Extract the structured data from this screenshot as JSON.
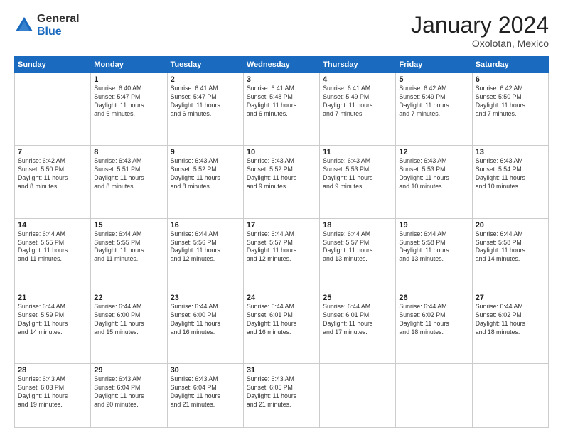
{
  "logo": {
    "general": "General",
    "blue": "Blue"
  },
  "header": {
    "month": "January 2024",
    "location": "Oxolotan, Mexico"
  },
  "weekdays": [
    "Sunday",
    "Monday",
    "Tuesday",
    "Wednesday",
    "Thursday",
    "Friday",
    "Saturday"
  ],
  "weeks": [
    [
      {
        "day": "",
        "info": ""
      },
      {
        "day": "1",
        "info": "Sunrise: 6:40 AM\nSunset: 5:47 PM\nDaylight: 11 hours\nand 6 minutes."
      },
      {
        "day": "2",
        "info": "Sunrise: 6:41 AM\nSunset: 5:47 PM\nDaylight: 11 hours\nand 6 minutes."
      },
      {
        "day": "3",
        "info": "Sunrise: 6:41 AM\nSunset: 5:48 PM\nDaylight: 11 hours\nand 6 minutes."
      },
      {
        "day": "4",
        "info": "Sunrise: 6:41 AM\nSunset: 5:49 PM\nDaylight: 11 hours\nand 7 minutes."
      },
      {
        "day": "5",
        "info": "Sunrise: 6:42 AM\nSunset: 5:49 PM\nDaylight: 11 hours\nand 7 minutes."
      },
      {
        "day": "6",
        "info": "Sunrise: 6:42 AM\nSunset: 5:50 PM\nDaylight: 11 hours\nand 7 minutes."
      }
    ],
    [
      {
        "day": "7",
        "info": "Sunrise: 6:42 AM\nSunset: 5:50 PM\nDaylight: 11 hours\nand 8 minutes."
      },
      {
        "day": "8",
        "info": "Sunrise: 6:43 AM\nSunset: 5:51 PM\nDaylight: 11 hours\nand 8 minutes."
      },
      {
        "day": "9",
        "info": "Sunrise: 6:43 AM\nSunset: 5:52 PM\nDaylight: 11 hours\nand 8 minutes."
      },
      {
        "day": "10",
        "info": "Sunrise: 6:43 AM\nSunset: 5:52 PM\nDaylight: 11 hours\nand 9 minutes."
      },
      {
        "day": "11",
        "info": "Sunrise: 6:43 AM\nSunset: 5:53 PM\nDaylight: 11 hours\nand 9 minutes."
      },
      {
        "day": "12",
        "info": "Sunrise: 6:43 AM\nSunset: 5:53 PM\nDaylight: 11 hours\nand 10 minutes."
      },
      {
        "day": "13",
        "info": "Sunrise: 6:43 AM\nSunset: 5:54 PM\nDaylight: 11 hours\nand 10 minutes."
      }
    ],
    [
      {
        "day": "14",
        "info": "Sunrise: 6:44 AM\nSunset: 5:55 PM\nDaylight: 11 hours\nand 11 minutes."
      },
      {
        "day": "15",
        "info": "Sunrise: 6:44 AM\nSunset: 5:55 PM\nDaylight: 11 hours\nand 11 minutes."
      },
      {
        "day": "16",
        "info": "Sunrise: 6:44 AM\nSunset: 5:56 PM\nDaylight: 11 hours\nand 12 minutes."
      },
      {
        "day": "17",
        "info": "Sunrise: 6:44 AM\nSunset: 5:57 PM\nDaylight: 11 hours\nand 12 minutes."
      },
      {
        "day": "18",
        "info": "Sunrise: 6:44 AM\nSunset: 5:57 PM\nDaylight: 11 hours\nand 13 minutes."
      },
      {
        "day": "19",
        "info": "Sunrise: 6:44 AM\nSunset: 5:58 PM\nDaylight: 11 hours\nand 13 minutes."
      },
      {
        "day": "20",
        "info": "Sunrise: 6:44 AM\nSunset: 5:58 PM\nDaylight: 11 hours\nand 14 minutes."
      }
    ],
    [
      {
        "day": "21",
        "info": "Sunrise: 6:44 AM\nSunset: 5:59 PM\nDaylight: 11 hours\nand 14 minutes."
      },
      {
        "day": "22",
        "info": "Sunrise: 6:44 AM\nSunset: 6:00 PM\nDaylight: 11 hours\nand 15 minutes."
      },
      {
        "day": "23",
        "info": "Sunrise: 6:44 AM\nSunset: 6:00 PM\nDaylight: 11 hours\nand 16 minutes."
      },
      {
        "day": "24",
        "info": "Sunrise: 6:44 AM\nSunset: 6:01 PM\nDaylight: 11 hours\nand 16 minutes."
      },
      {
        "day": "25",
        "info": "Sunrise: 6:44 AM\nSunset: 6:01 PM\nDaylight: 11 hours\nand 17 minutes."
      },
      {
        "day": "26",
        "info": "Sunrise: 6:44 AM\nSunset: 6:02 PM\nDaylight: 11 hours\nand 18 minutes."
      },
      {
        "day": "27",
        "info": "Sunrise: 6:44 AM\nSunset: 6:02 PM\nDaylight: 11 hours\nand 18 minutes."
      }
    ],
    [
      {
        "day": "28",
        "info": "Sunrise: 6:43 AM\nSunset: 6:03 PM\nDaylight: 11 hours\nand 19 minutes."
      },
      {
        "day": "29",
        "info": "Sunrise: 6:43 AM\nSunset: 6:04 PM\nDaylight: 11 hours\nand 20 minutes."
      },
      {
        "day": "30",
        "info": "Sunrise: 6:43 AM\nSunset: 6:04 PM\nDaylight: 11 hours\nand 21 minutes."
      },
      {
        "day": "31",
        "info": "Sunrise: 6:43 AM\nSunset: 6:05 PM\nDaylight: 11 hours\nand 21 minutes."
      },
      {
        "day": "",
        "info": ""
      },
      {
        "day": "",
        "info": ""
      },
      {
        "day": "",
        "info": ""
      }
    ]
  ]
}
